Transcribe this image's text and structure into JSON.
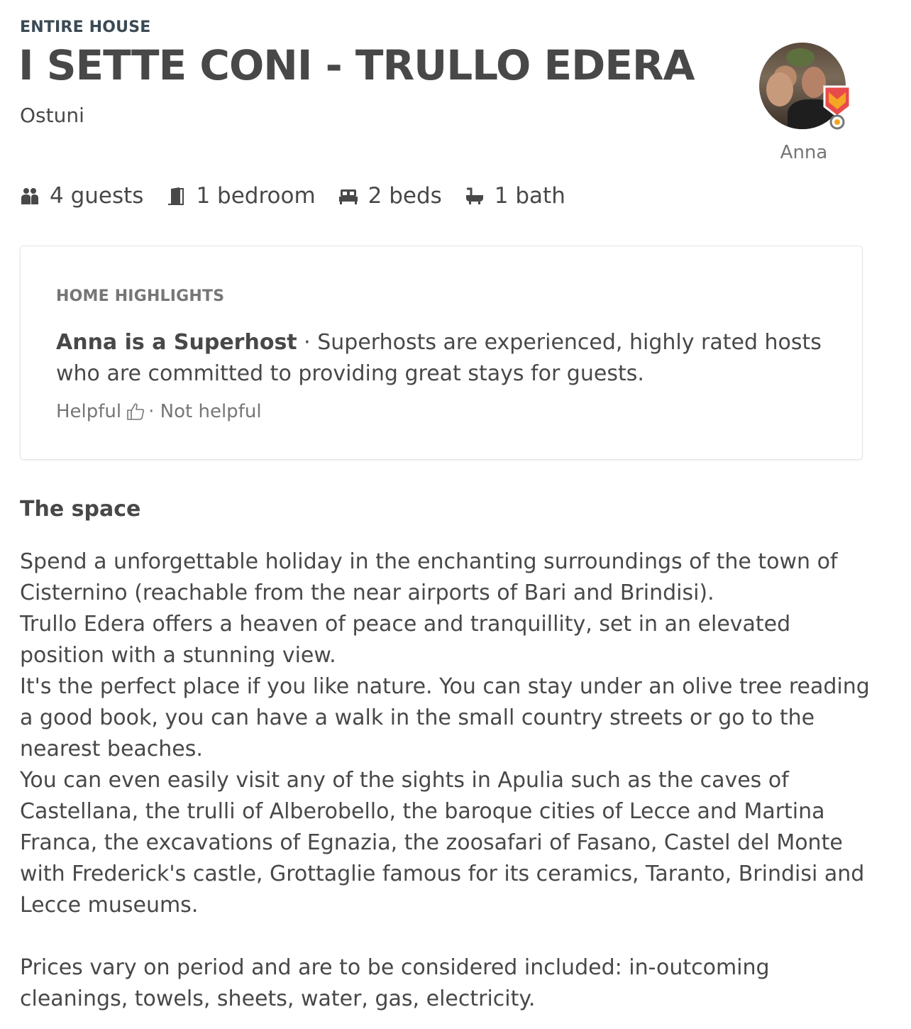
{
  "listing": {
    "kicker": "ENTIRE HOUSE",
    "title": "I SETTE CONI - TRULLO EDERA",
    "location": "Ostuni"
  },
  "host": {
    "name": "Anna",
    "badge_colors": [
      "#e94b4b",
      "#f5a623"
    ]
  },
  "amenities": [
    {
      "icon": "guests-icon",
      "label": "4 guests"
    },
    {
      "icon": "door-icon",
      "label": "1 bedroom"
    },
    {
      "icon": "bed-icon",
      "label": "2 beds"
    },
    {
      "icon": "bath-icon",
      "label": "1 bath"
    }
  ],
  "highlights": {
    "heading": "HOME HIGHLIGHTS",
    "bold_text": "Anna is a Superhost",
    "separator": " · ",
    "text": "Superhosts are experienced, highly rated hosts who are committed to providing great stays for guests.",
    "helpful_label": "Helpful",
    "helpful_icon": "thumbs-up-icon",
    "not_helpful_label": "· Not helpful"
  },
  "space": {
    "heading": "The space",
    "paragraphs": [
      "Spend a unforgettable holiday in the enchanting surroundings of the town of Cisternino (reachable from the near airports of Bari and Brindisi).",
      "Trullo Edera offers a heaven of peace and tranquillity, set in an elevated position with a stunning view.",
      "It's the perfect place if you like nature. You can stay under an olive tree reading a good book, you can have a walk in the small country streets or go to the nearest beaches.",
      "You can even easily visit any of the sights in Apulia such as the caves of Castellana, the trulli of Alberobello, the baroque cities of Lecce and Martina Franca, the excavations of Egnazia, the zoosafari of Fasano, Castel del Monte with Frederick's castle, Grottaglie famous for its ceramics, Taranto, Brindisi and Lecce museums.",
      "Prices vary on period and are to be considered included: in-outcoming cleanings, towels, sheets, water, gas, electricity."
    ]
  }
}
